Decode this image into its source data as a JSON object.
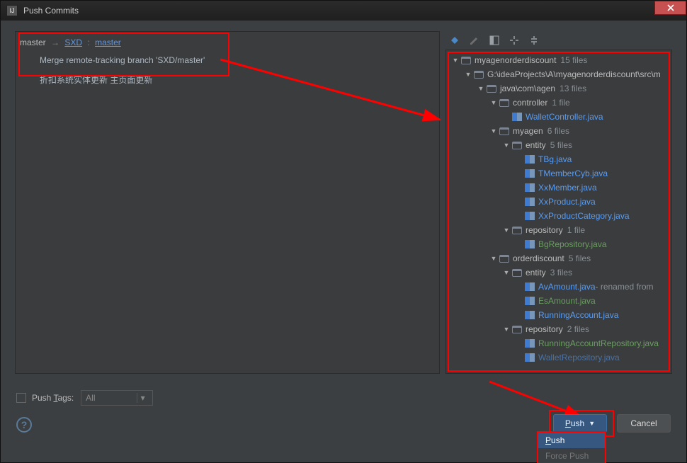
{
  "window": {
    "title": "Push Commits"
  },
  "left": {
    "local_branch": "master",
    "arrow": "→",
    "remote_name": "SXD",
    "colon": ":",
    "remote_branch": "master",
    "commits": [
      "Merge remote-tracking branch 'SXD/master'",
      "折扣系统实体更新 主页面更新"
    ]
  },
  "tree": [
    {
      "depth": 0,
      "kind": "root",
      "label": "myagenorderdiscount",
      "count": "15 files",
      "open": true,
      "interactable": true
    },
    {
      "depth": 1,
      "kind": "folder",
      "label": "G:\\ideaProjects\\A\\myagenorderdiscount\\src\\m",
      "open": true,
      "interactable": true
    },
    {
      "depth": 2,
      "kind": "folder",
      "label": "java\\com\\agen",
      "count": "13 files",
      "open": true,
      "interactable": true
    },
    {
      "depth": 3,
      "kind": "folder",
      "label": "controller",
      "count": "1 file",
      "open": true,
      "interactable": true
    },
    {
      "depth": 4,
      "kind": "file",
      "label": "WalletController.java",
      "color": "blue",
      "interactable": true
    },
    {
      "depth": 3,
      "kind": "folder",
      "label": "myagen",
      "count": "6 files",
      "open": true,
      "interactable": true
    },
    {
      "depth": 4,
      "kind": "folder",
      "label": "entity",
      "count": "5 files",
      "open": true,
      "interactable": true
    },
    {
      "depth": 5,
      "kind": "file",
      "label": "TBg.java",
      "color": "blue",
      "interactable": true
    },
    {
      "depth": 5,
      "kind": "file",
      "label": "TMemberCyb.java",
      "color": "blue",
      "interactable": true
    },
    {
      "depth": 5,
      "kind": "file",
      "label": "XxMember.java",
      "color": "blue",
      "interactable": true
    },
    {
      "depth": 5,
      "kind": "file",
      "label": "XxProduct.java",
      "color": "blue",
      "interactable": true
    },
    {
      "depth": 5,
      "kind": "file",
      "label": "XxProductCategory.java",
      "color": "blue",
      "interactable": true
    },
    {
      "depth": 4,
      "kind": "folder",
      "label": "repository",
      "count": "1 file",
      "open": true,
      "interactable": true
    },
    {
      "depth": 5,
      "kind": "file",
      "label": "BgRepository.java",
      "color": "green",
      "interactable": true
    },
    {
      "depth": 3,
      "kind": "folder",
      "label": "orderdiscount",
      "count": "5 files",
      "open": true,
      "interactable": true
    },
    {
      "depth": 4,
      "kind": "folder",
      "label": "entity",
      "count": "3 files",
      "open": true,
      "interactable": true
    },
    {
      "depth": 5,
      "kind": "file",
      "label": "AvAmount.java",
      "color": "blue",
      "suffix": " - renamed from",
      "interactable": true
    },
    {
      "depth": 5,
      "kind": "file",
      "label": "EsAmount.java",
      "color": "green",
      "interactable": true
    },
    {
      "depth": 5,
      "kind": "file",
      "label": "RunningAccount.java",
      "color": "blue",
      "interactable": true
    },
    {
      "depth": 4,
      "kind": "folder",
      "label": "repository",
      "count": "2 files",
      "open": true,
      "interactable": true
    },
    {
      "depth": 5,
      "kind": "file",
      "label": "RunningAccountRepository.java",
      "color": "green",
      "interactable": true
    },
    {
      "depth": 5,
      "kind": "file",
      "label": "WalletRepository.java",
      "color": "blue",
      "cut": true,
      "interactable": true
    }
  ],
  "push_tags": {
    "label": "Push Tags:",
    "checkbox": false,
    "combo_placeholder": "All"
  },
  "buttons": {
    "push": "Push",
    "cancel": "Cancel",
    "menu": [
      {
        "label": "Push",
        "selected": true
      },
      {
        "label": "Force Push",
        "disabled": true
      }
    ]
  },
  "help_tooltip": "?",
  "icons": {
    "app": "IJ",
    "close": "×",
    "toolbar": [
      "pin-icon",
      "edit-icon",
      "layout-icon",
      "settings-icon",
      "collapse-icon"
    ]
  }
}
